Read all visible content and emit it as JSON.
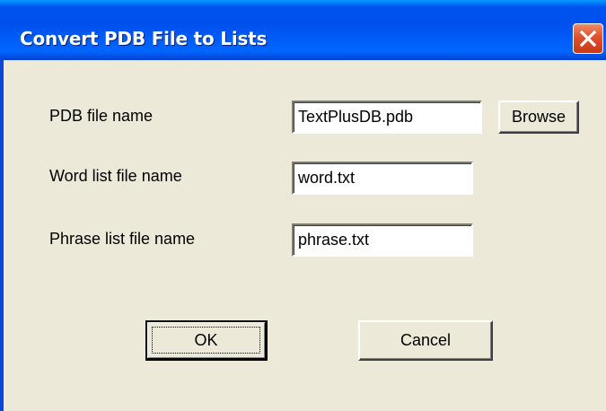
{
  "window": {
    "title": "Convert PDB File to Lists",
    "close_icon": "close-icon"
  },
  "form": {
    "pdb_label": "PDB file name",
    "pdb_value": "TextPlusDB.pdb",
    "browse_label": "Browse",
    "word_label": "Word list file name",
    "word_value": "word.txt",
    "phrase_label": "Phrase list file name",
    "phrase_value": "phrase.txt"
  },
  "buttons": {
    "ok_label": "OK",
    "cancel_label": "Cancel"
  },
  "colors": {
    "titlebar": "#0053ee",
    "close_button": "#e0502c",
    "client_background": "#ece9d8"
  }
}
